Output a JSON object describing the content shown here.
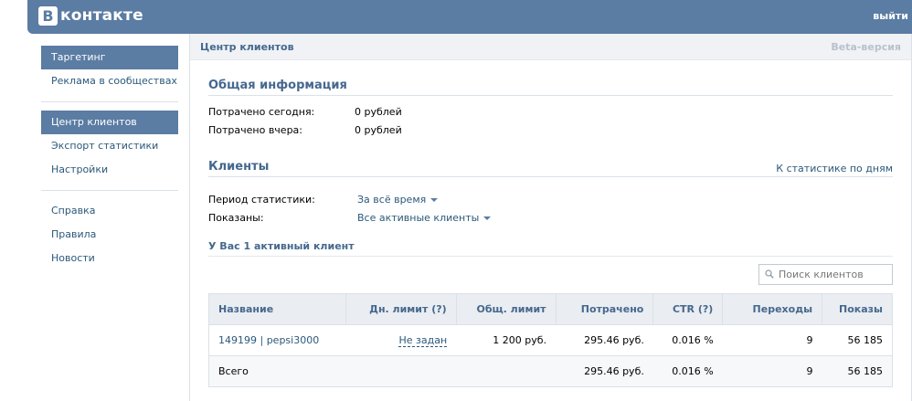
{
  "header": {
    "logo_letter": "B",
    "logo_text": "контакте",
    "logout": "выйти"
  },
  "sidebar": {
    "group1": [
      {
        "label": "Таргетинг"
      },
      {
        "label": "Реклама в сообществах"
      }
    ],
    "group2": [
      {
        "label": "Центр клиентов"
      },
      {
        "label": "Экспорт статистики"
      },
      {
        "label": "Настройки"
      }
    ],
    "group3": [
      {
        "label": "Справка"
      },
      {
        "label": "Правила"
      },
      {
        "label": "Новости"
      }
    ]
  },
  "page": {
    "title": "Центр клиентов",
    "beta": "Beta-версия"
  },
  "general": {
    "title": "Общая информация",
    "spent_today_label": "Потрачено сегодня:",
    "spent_today_value": "0 рублей",
    "spent_yesterday_label": "Потрачено вчера:",
    "spent_yesterday_value": "0 рублей"
  },
  "clients": {
    "title": "Клиенты",
    "daily_stats_link": "К статистике по дням",
    "period_label": "Период статистики:",
    "period_value": "За всё время",
    "shown_label": "Показаны:",
    "shown_value": "Все активные клиенты",
    "active_count": "У Вас 1 активный клиент",
    "search_placeholder": "Поиск клиентов"
  },
  "table": {
    "columns": [
      "Название",
      "Дн. лимит (?)",
      "Общ. лимит",
      "Потрачено",
      "CTR (?)",
      "Переходы",
      "Показы"
    ],
    "rows": [
      {
        "name": "149199 | pepsi3000",
        "daily_limit": "Не задан",
        "total_limit": "1 200 руб.",
        "spent": "295.46 руб.",
        "ctr": "0.016 %",
        "clicks": "9",
        "impressions": "56 185"
      }
    ],
    "total": {
      "name": "Всего",
      "daily_limit": "",
      "total_limit": "",
      "spent": "295.46 руб.",
      "ctr": "0.016 %",
      "clicks": "9",
      "impressions": "56 185"
    }
  },
  "colors": {
    "brand": "#5b7ca3",
    "link": "#2b587a",
    "heading": "#45688e"
  }
}
